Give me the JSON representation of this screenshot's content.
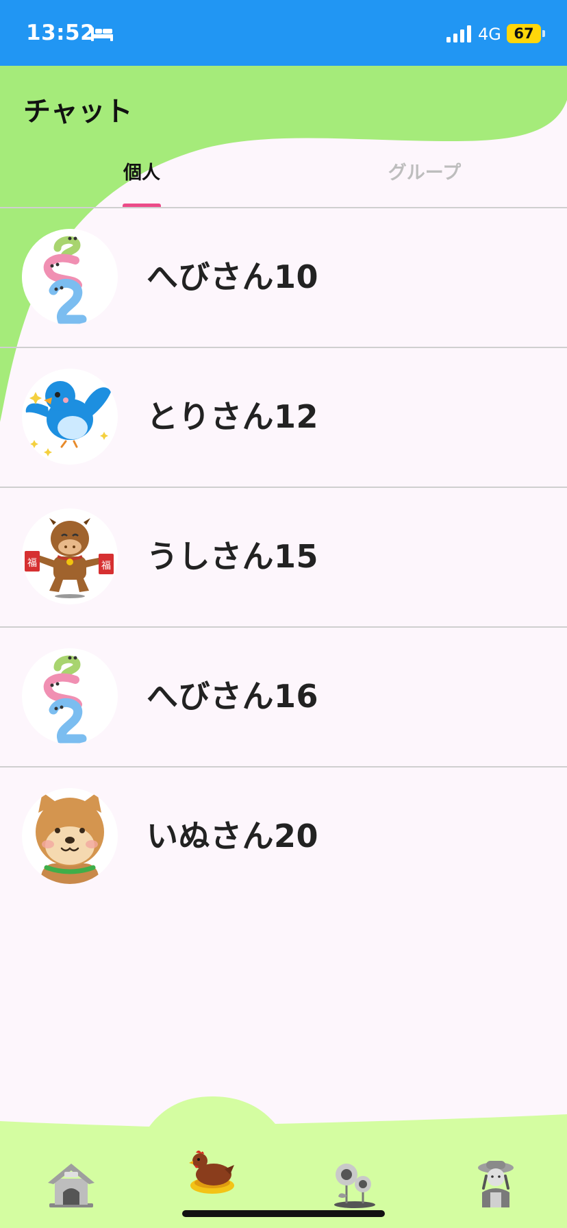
{
  "status_bar": {
    "time": "13:52",
    "network": "4G",
    "battery": "67",
    "icons": [
      "bed-icon",
      "signal-icon"
    ],
    "background_color": "#2196f3"
  },
  "header": {
    "title": "チャット",
    "background_color": "#a5eb7a"
  },
  "tabs": [
    {
      "label": "個人",
      "active": true
    },
    {
      "label": "グループ",
      "active": false
    }
  ],
  "tab_indicator_color": "#ec4c89",
  "chats": [
    {
      "name": "へびさん10",
      "avatar": "snake-avatar"
    },
    {
      "name": "とりさん12",
      "avatar": "bird-avatar"
    },
    {
      "name": "うしさん15",
      "avatar": "cow-avatar"
    },
    {
      "name": "へびさん16",
      "avatar": "snake-avatar"
    },
    {
      "name": "いぬさん20",
      "avatar": "dog-avatar"
    }
  ],
  "bottom_nav": {
    "background_color": "#d4fda1",
    "items": [
      {
        "icon": "doghouse-icon",
        "active": false
      },
      {
        "icon": "hen-icon",
        "active": true
      },
      {
        "icon": "sunflower-icon",
        "active": false
      },
      {
        "icon": "farmer-icon",
        "active": false
      }
    ]
  }
}
